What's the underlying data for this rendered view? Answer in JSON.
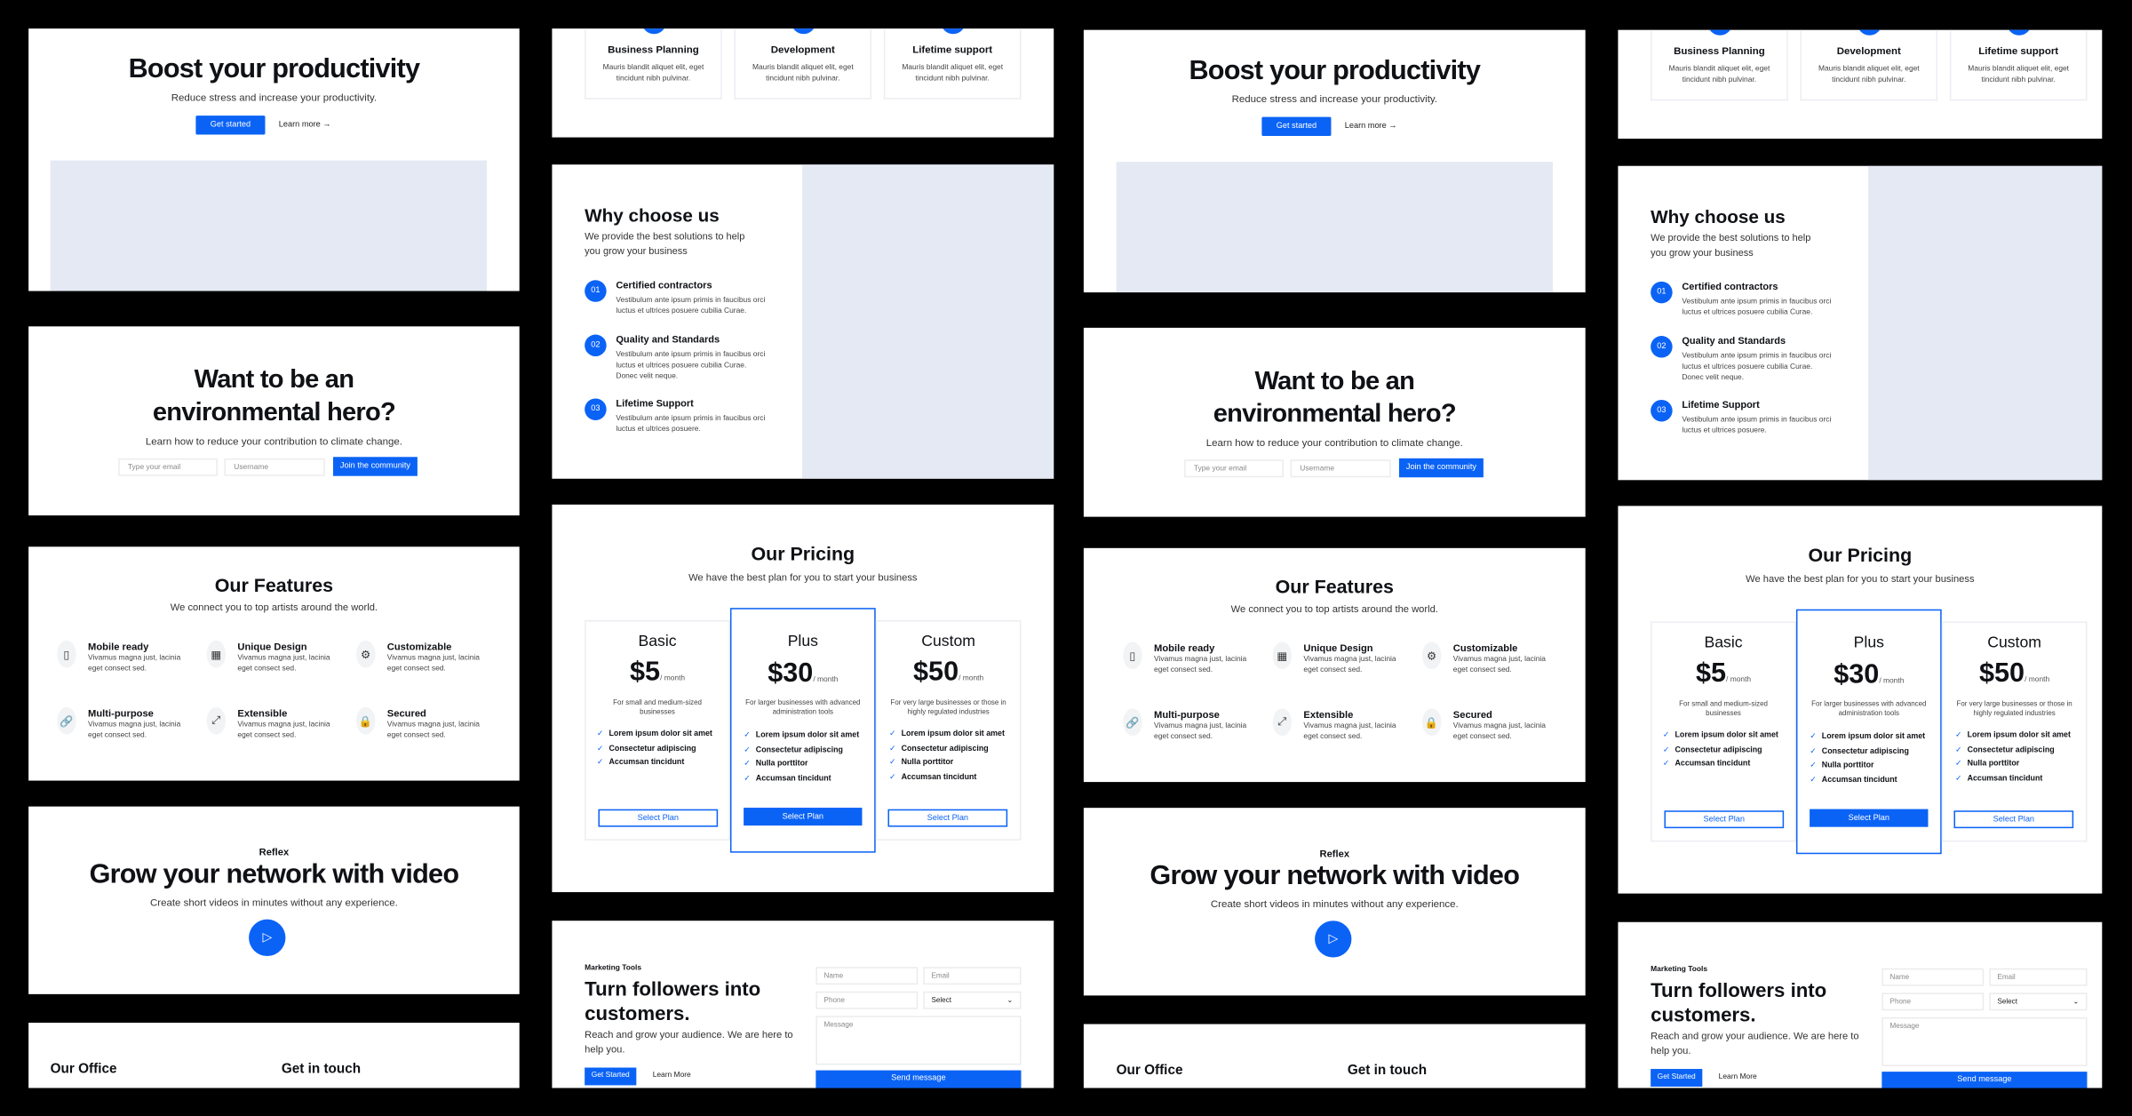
{
  "hero": {
    "title": "Boost your productivity",
    "subtitle": "Reduce stress and increase your productivity.",
    "cta": "Get started",
    "learn": "Learn more",
    "arrow": "→"
  },
  "top_features": {
    "items": [
      {
        "title": "Business Planning",
        "desc": "Mauris blandit aliquet elit, eget tincidunt nibh pulvinar."
      },
      {
        "title": "Development",
        "desc": "Mauris blandit aliquet elit, eget tincidunt nibh pulvinar."
      },
      {
        "title": "Lifetime support",
        "desc": "Mauris blandit aliquet elit, eget tincidunt nibh pulvinar."
      }
    ]
  },
  "why": {
    "title": "Why choose us",
    "subtitle": "We provide the best solutions to help you grow your business",
    "items": [
      {
        "num": "01",
        "title": "Certified contractors",
        "desc": "Vestibulum ante ipsum primis in faucibus orci luctus et ultrices posuere cubilia Curae."
      },
      {
        "num": "02",
        "title": "Quality and Standards",
        "desc": "Vestibulum ante ipsum primis in faucibus orci luctus et ultrices posuere cubilia Curae. Donec velit neque."
      },
      {
        "num": "03",
        "title": "Lifetime Support",
        "desc": "Vestibulum ante ipsum primis in faucibus orci luctus et ultrices posuere."
      }
    ]
  },
  "env": {
    "title_line1": "Want to be an",
    "title_line2": "environmental hero?",
    "subtitle": "Learn how to reduce your contribution to climate change.",
    "email_placeholder": "Type your email",
    "username_placeholder": "Username",
    "join": "Join the community"
  },
  "features": {
    "title": "Our Features",
    "subtitle": "We connect you to top artists around the world.",
    "items": [
      {
        "icon": "▯",
        "title": "Mobile ready",
        "desc": "Vivamus magna just, lacinia eget consect sed."
      },
      {
        "icon": "▦",
        "title": "Unique Design",
        "desc": "Vivamus magna just, lacinia eget consect sed."
      },
      {
        "icon": "⚙",
        "title": "Customizable",
        "desc": "Vivamus magna just, lacinia eget consect sed."
      },
      {
        "icon": "🔗",
        "title": "Multi-purpose",
        "desc": "Vivamus magna just, lacinia eget consect sed."
      },
      {
        "icon": "⤢",
        "title": "Extensible",
        "desc": "Vivamus magna just, lacinia eget consect sed."
      },
      {
        "icon": "🔒",
        "title": "Secured",
        "desc": "Vivamus magna just, lacinia eget consect sed."
      }
    ]
  },
  "pricing": {
    "title": "Our Pricing",
    "subtitle": "We have the best plan for you to start your business",
    "check": "✓",
    "plans": [
      {
        "name": "Basic",
        "price": "$5",
        "per": "/ month",
        "desc": "For small and medium-sized businesses",
        "features": [
          "Lorem ipsum dolor sit amet",
          "Consectetur adipiscing",
          "Accumsan tincidunt"
        ],
        "cta": "Select Plan"
      },
      {
        "name": "Plus",
        "price": "$30",
        "per": "/ month",
        "desc": "For larger businesses with advanced administration tools",
        "features": [
          "Lorem ipsum dolor sit amet",
          "Consectetur adipiscing",
          "Nulla porttitor",
          "Accumsan tincidunt"
        ],
        "cta": "Select Plan"
      },
      {
        "name": "Custom",
        "price": "$50",
        "per": "/ month",
        "desc": "For very large businesses or those in highly regulated industries",
        "features": [
          "Lorem ipsum dolor sit amet",
          "Consectetur adipiscing",
          "Nulla porttitor",
          "Accumsan tincidunt"
        ],
        "cta": "Select Plan"
      }
    ]
  },
  "video": {
    "brand": "Reflex",
    "title": "Grow your network with video",
    "subtitle": "Create short videos in minutes without any experience.",
    "play": "▷"
  },
  "marketing": {
    "tag": "Marketing Tools",
    "title_line1": "Turn followers into",
    "title_line2": "customers.",
    "subtitle": "Reach and grow your audience. We are here to help you.",
    "cta": "Get Started",
    "learn": "Learn More",
    "name_placeholder": "Name",
    "email_placeholder": "Email",
    "phone_placeholder": "Phone",
    "select_value": "Select",
    "chevron": "⌄",
    "message_placeholder": "Message",
    "send": "Send message"
  },
  "office": {
    "left_title": "Our Office",
    "right_title": "Get in touch"
  },
  "colors": {
    "accent": "#0b63f6",
    "placeholder": "#e4e9f4"
  }
}
